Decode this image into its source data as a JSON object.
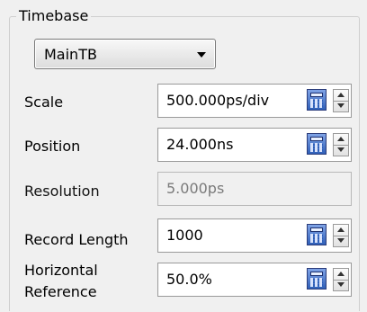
{
  "group": {
    "title": "Timebase"
  },
  "timebase_select": {
    "value": "MainTB"
  },
  "rows": {
    "scale": {
      "label": "Scale",
      "value": "500.000ps/div"
    },
    "position": {
      "label": "Position",
      "value": "24.000ns"
    },
    "resolution": {
      "label": "Resolution",
      "value": "5.000ps"
    },
    "record_length": {
      "label": "Record Length",
      "value": "1000"
    },
    "horizontal_reference": {
      "label_line1": "Horizontal",
      "label_line2": "Reference",
      "value": "50.0%"
    }
  },
  "icons": {
    "calculator": "calculator-icon",
    "spin_up": "arrow-up-icon",
    "spin_down": "arrow-down-icon",
    "dropdown": "chevron-down-icon"
  }
}
